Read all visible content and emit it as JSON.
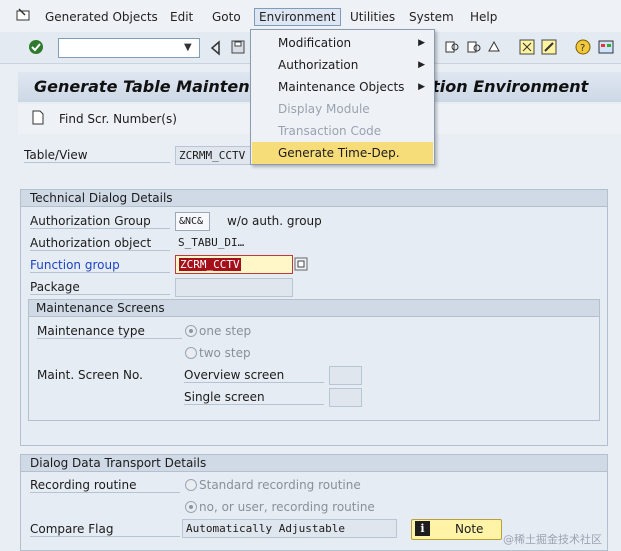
{
  "menubar": {
    "items": [
      "Generated Objects",
      "Edit",
      "Goto",
      "Environment",
      "Utilities",
      "System",
      "Help"
    ]
  },
  "toolbar": {
    "command_value": "",
    "icons": [
      "enter-icon",
      "back-icon",
      "save-icon",
      "find-icon",
      "shortcut-icon",
      "help-icon",
      "layout-icon"
    ]
  },
  "title": {
    "text": "Generate Table Maintenance Dialog: Generation Environment",
    "app_button": "Find Scr. Number(s)"
  },
  "environment_menu": {
    "items": [
      {
        "label": "Modification",
        "submenu": true,
        "enabled": true,
        "highlighted": false
      },
      {
        "label": "Authorization",
        "submenu": true,
        "enabled": true,
        "highlighted": false
      },
      {
        "label": "Maintenance Objects",
        "submenu": true,
        "enabled": true,
        "highlighted": false
      },
      {
        "label": "Display Module",
        "submenu": false,
        "enabled": false,
        "highlighted": false
      },
      {
        "label": "Transaction Code",
        "submenu": false,
        "enabled": false,
        "highlighted": false
      },
      {
        "label": "Generate Time-Dep.",
        "submenu": false,
        "enabled": true,
        "highlighted": true
      }
    ]
  },
  "header": {
    "table_view_label": "Table/View",
    "table_view_value": "ZCRMM_CCTV"
  },
  "technical": {
    "title": "Technical Dialog Details",
    "auth_group_label": "Authorization Group",
    "auth_group_value": "&NC&",
    "auth_group_desc": "w/o auth. group",
    "auth_object_label": "Authorization object",
    "auth_object_value": "S_TABU_DI…",
    "function_group_label": "Function group",
    "function_group_value": "ZCRM_CCTV",
    "package_label": "Package",
    "package_value": ""
  },
  "maintenance": {
    "title": "Maintenance Screens",
    "type_label": "Maintenance type",
    "one_step": "one step",
    "two_step": "two step",
    "screen_no_label": "Maint. Screen No.",
    "overview_label": "Overview screen",
    "single_label": "Single screen",
    "overview_value": "",
    "single_value": ""
  },
  "transport": {
    "title": "Dialog Data Transport Details",
    "recording_label": "Recording routine",
    "standard_option": "Standard recording routine",
    "user_option": "no, or user, recording routine",
    "compare_label": "Compare Flag",
    "compare_value": "Automatically Adjustable",
    "note_button": "Note",
    "note_icon_glyph": "i"
  },
  "watermark": "@稀土掘金技术社区",
  "colors": {
    "highlight": "#f7dc7a",
    "link": "#1d44c2",
    "selection": "#a50f1a"
  }
}
